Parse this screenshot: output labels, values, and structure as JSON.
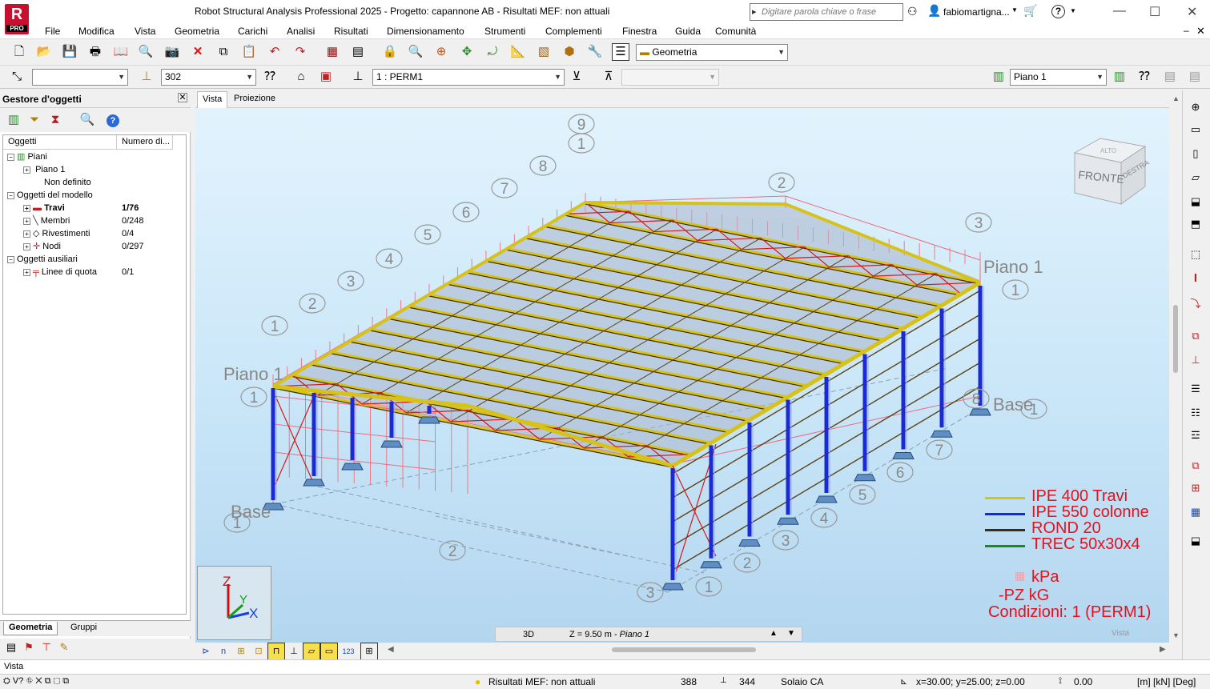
{
  "titlebar": {
    "logo_letter": "R",
    "logo_sub": "PRO",
    "title": "Robot Structural Analysis Professional 2025 - Progetto: capannone AB - Risultati MEF: non attuali",
    "search_placeholder": "Digitare parola chiave o frase",
    "user": "fabiomartigna...",
    "help": "?"
  },
  "menu": [
    "File",
    "Modifica",
    "Vista",
    "Geometria",
    "Carichi",
    "Analisi",
    "Risultati",
    "Dimensionamento",
    "Strumenti",
    "Complementi",
    "Finestra",
    "Guida",
    "Comunità"
  ],
  "toolbar1": {
    "layout_combo": "Geometria"
  },
  "toolbar2": {
    "combo_blank": "",
    "section_combo": "302",
    "case_combo": "1 : PERM1",
    "storey_combo": "Piano 1"
  },
  "object_manager": {
    "title": "Gestore d'oggetti",
    "col_objects": "Oggetti",
    "col_count": "Numero di...",
    "tree": [
      {
        "label": "Piani",
        "value": "",
        "level": 0
      },
      {
        "label": "Piano 1",
        "value": "",
        "level": 1
      },
      {
        "label": "Non definito",
        "value": "",
        "level": 1
      },
      {
        "label": "Oggetti del modello",
        "value": "",
        "level": 0
      },
      {
        "label": "Travi",
        "value": "1/76",
        "level": 1
      },
      {
        "label": "Membri",
        "value": "0/248",
        "level": 1
      },
      {
        "label": "Rivestimenti",
        "value": "0/4",
        "level": 1
      },
      {
        "label": "Nodi",
        "value": "0/297",
        "level": 1
      },
      {
        "label": "Oggetti ausiliari",
        "value": "",
        "level": 0
      },
      {
        "label": "Linee di quota",
        "value": "0/1",
        "level": 1
      }
    ],
    "tabs": [
      "Geometria",
      "Gruppi"
    ]
  },
  "view": {
    "tabs": [
      "Vista",
      "Proiezione"
    ],
    "cube_front": "FRONTE",
    "cube_right": "DESTRA",
    "cube_top": "ALTO",
    "storey_labels": [
      "Piano 1",
      "Piano 1",
      "Base",
      "Base"
    ],
    "grid_labels": [
      "9",
      "1",
      "8",
      "7",
      "6",
      "5",
      "4",
      "3",
      "2",
      "1",
      "1",
      "2",
      "3",
      "1",
      "8",
      "7",
      "6",
      "5",
      "4",
      "3",
      "2",
      "1",
      "3",
      "2",
      "1",
      "1"
    ],
    "axes": {
      "z": "Z",
      "y": "Y",
      "x": "X"
    },
    "legend": [
      {
        "label": "IPE 400 Travi",
        "color": "#d7c21a"
      },
      {
        "label": "IPE 550 colonne",
        "color": "#1a2bd6"
      },
      {
        "label": "ROND 20",
        "color": "#3c2e10"
      },
      {
        "label": "TREC 50x30x4",
        "color": "#1a8a1a"
      }
    ],
    "units_1": "kPa",
    "units_2": "-PZ kG",
    "conditions": "Condizioni: 1 (PERM1)",
    "status_mode": "3D",
    "status_level": "Z = 9.50 m - ",
    "status_level_name": "Piano 1",
    "corner_label": "Vista"
  },
  "command_line": "Vista",
  "statusbar": {
    "results": "Risultati MEF: non attuali",
    "count1": "388",
    "count2": "344",
    "material": "Solaio CA",
    "coords": "x=30.00; y=25.00; z=0.00",
    "angle": "0.00",
    "units": "[m] [kN] [Deg]"
  }
}
